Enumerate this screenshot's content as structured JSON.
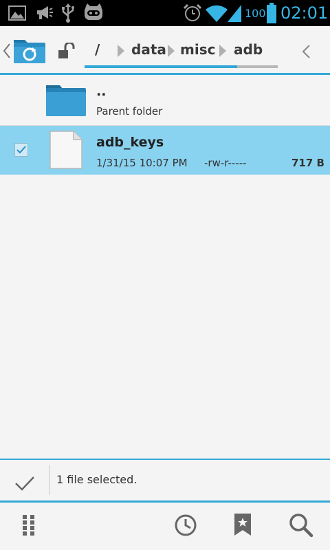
{
  "status_bar": {
    "battery_level": "100",
    "time": "02:01",
    "left_icons": [
      "gallery-icon",
      "megaphone-icon",
      "usb-icon",
      "cyanogen-icon"
    ],
    "right_icons": [
      "alarm-icon",
      "wifi-icon",
      "signal-icon",
      "battery-icon"
    ]
  },
  "navbar": {
    "breadcrumbs": [
      {
        "label": "/"
      },
      {
        "label": "data"
      },
      {
        "label": "misc"
      },
      {
        "label": "adb"
      }
    ],
    "scroll_position_percent": 79
  },
  "list": {
    "items": [
      {
        "name": "..",
        "subtitle": "Parent folder",
        "type": "folder"
      },
      {
        "name": "adb_keys",
        "date": "1/31/15 10:07 PM",
        "permissions": "-rw-r-----",
        "size": "717 B",
        "type": "file",
        "selected": true
      }
    ]
  },
  "selection": {
    "status": "1 file selected."
  },
  "toolbar": {
    "icons": [
      "apps-grid-icon",
      "history-icon",
      "bookmark-icon",
      "search-icon"
    ]
  },
  "colors": {
    "accent": "#33a8d8",
    "selected_row": "#8ad3f0",
    "status_text": "#36b5e5"
  }
}
